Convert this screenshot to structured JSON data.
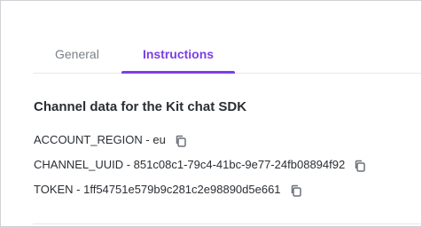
{
  "tabs": [
    {
      "label": "General"
    },
    {
      "label": "Instructions"
    }
  ],
  "section": {
    "heading": "Channel data for the Kit chat SDK",
    "rows": [
      {
        "text": "ACCOUNT_REGION - eu"
      },
      {
        "text": "CHANNEL_UUID - 851c08c1-79c4-41bc-9e77-24fb08894f92"
      },
      {
        "text": "TOKEN - 1ff54751e579b9c281c2e98890d5e661"
      }
    ]
  },
  "colors": {
    "accent": "#7b3fe4",
    "text": "#2a2e33",
    "muted": "#7b8088"
  },
  "icons": {
    "copy": "copy-icon"
  }
}
